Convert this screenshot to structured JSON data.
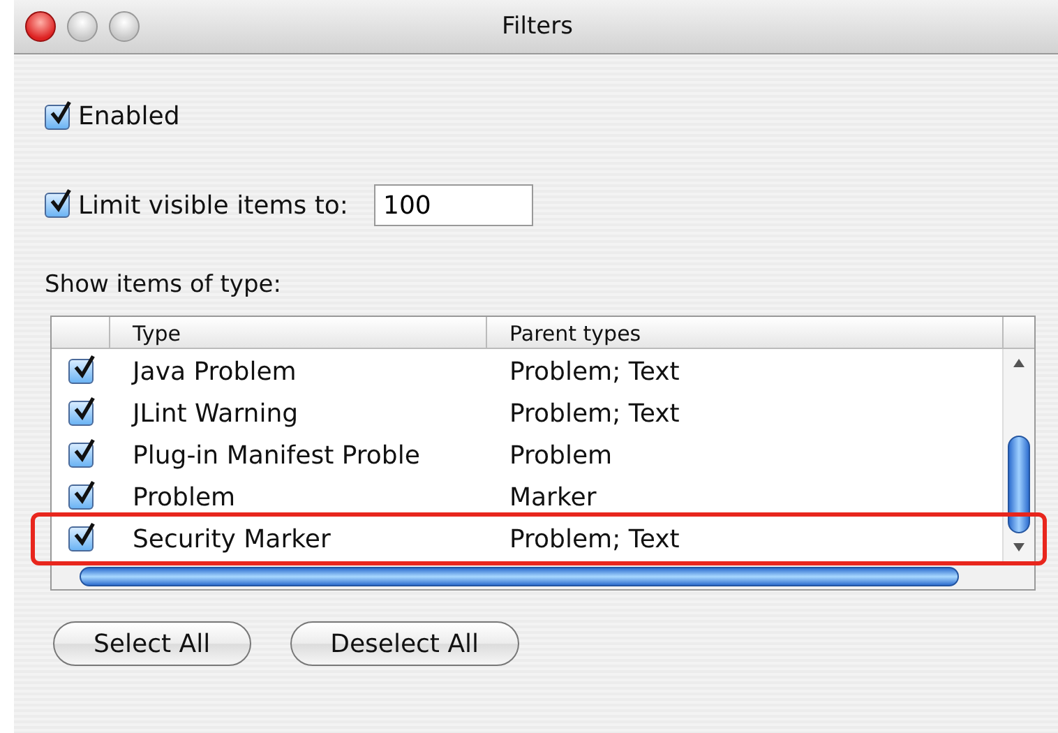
{
  "window": {
    "title": "Filters"
  },
  "enabled": {
    "label": "Enabled",
    "checked": true
  },
  "limit": {
    "label": "Limit visible items to:",
    "checked": true,
    "value": "100"
  },
  "types_label": "Show items of type:",
  "table": {
    "columns": [
      "Type",
      "Parent types"
    ],
    "rows": [
      {
        "type": "Java Problem",
        "parents": "Problem; Text",
        "checked": true,
        "highlighted": false
      },
      {
        "type": "JLint Warning",
        "parents": "Problem; Text",
        "checked": true,
        "highlighted": false
      },
      {
        "type": "Plug-in Manifest Proble",
        "parents": "Problem",
        "checked": true,
        "highlighted": false
      },
      {
        "type": "Problem",
        "parents": "Marker",
        "checked": true,
        "highlighted": false
      },
      {
        "type": "Security Marker",
        "parents": "Problem; Text",
        "checked": true,
        "highlighted": true
      }
    ]
  },
  "buttons": [
    "Select All",
    "Deselect All"
  ]
}
